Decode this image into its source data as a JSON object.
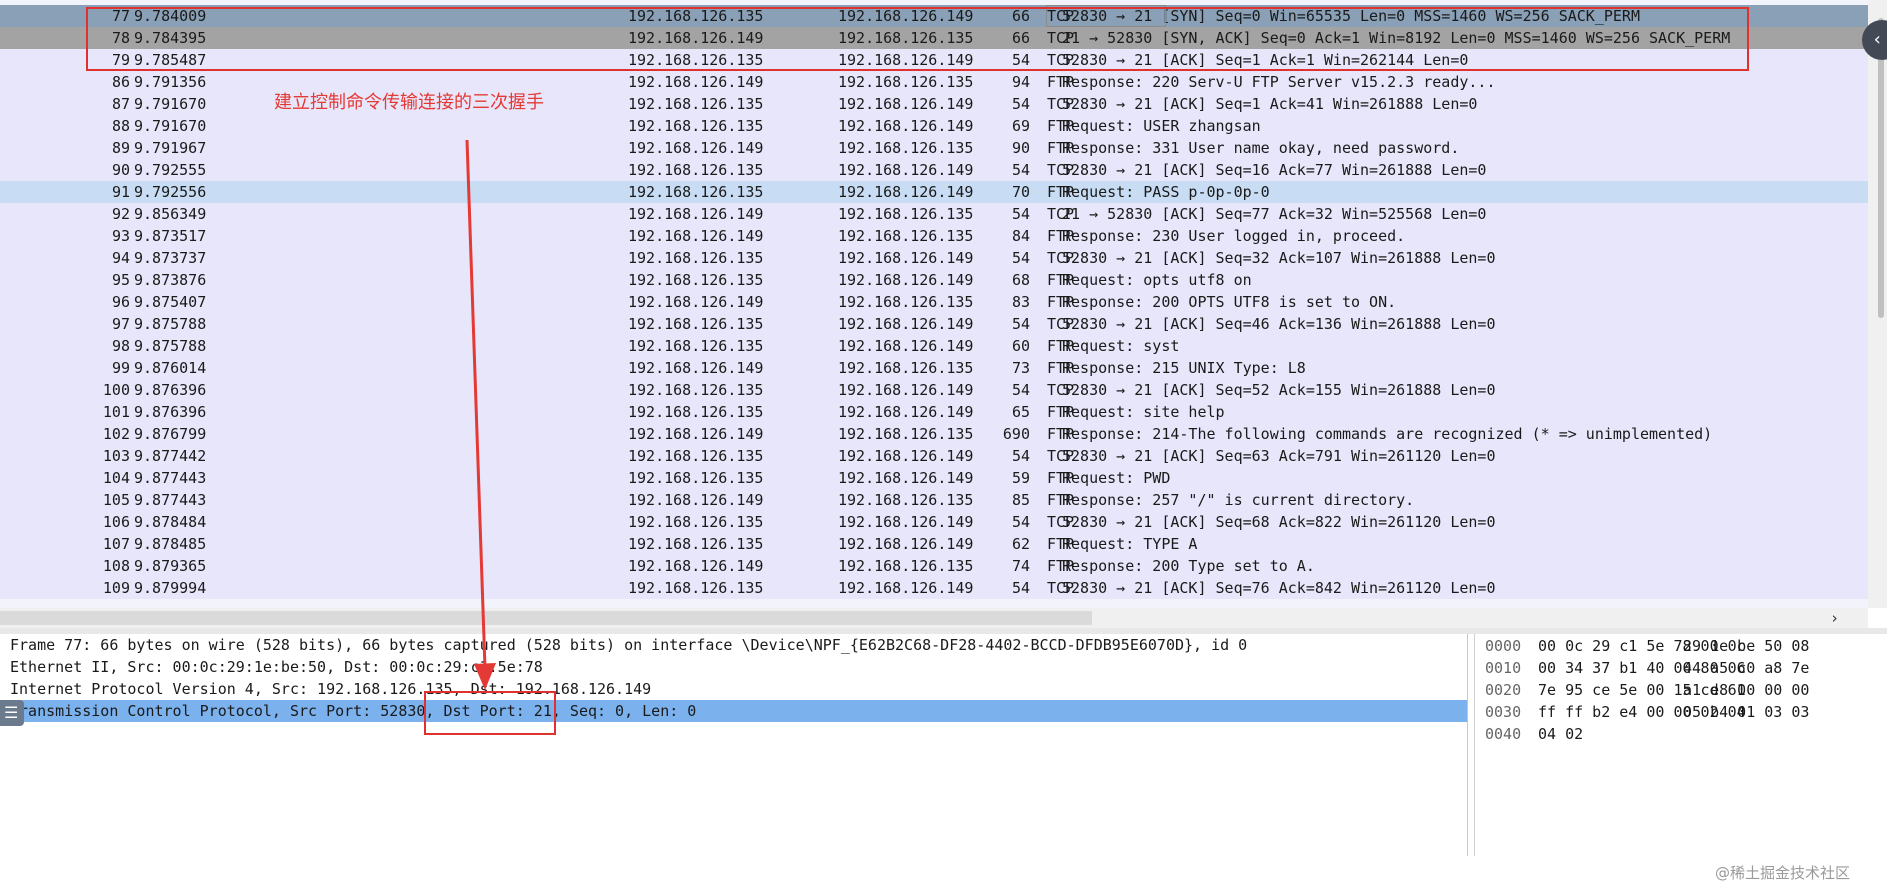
{
  "packet_list": {
    "rows": [
      {
        "no": "77",
        "time": "9.784009",
        "src": "192.168.126.135",
        "dst": "192.168.126.149",
        "proto": "TCP",
        "len": "66",
        "info": "52830 → 21 [SYN] Seq=0 Win=65535 Len=0 MSS=1460 WS=256 SACK_PERM"
      },
      {
        "no": "78",
        "time": "9.784395",
        "src": "192.168.126.149",
        "dst": "192.168.126.135",
        "proto": "TCP",
        "len": "66",
        "info": "21 → 52830 [SYN, ACK] Seq=0 Ack=1 Win=8192 Len=0 MSS=1460 WS=256 SACK_PERM"
      },
      {
        "no": "79",
        "time": "9.785487",
        "src": "192.168.126.135",
        "dst": "192.168.126.149",
        "proto": "TCP",
        "len": "54",
        "info": "52830 → 21 [ACK] Seq=1 Ack=1 Win=262144 Len=0"
      },
      {
        "no": "86",
        "time": "9.791356",
        "src": "192.168.126.149",
        "dst": "192.168.126.135",
        "proto": "FTP",
        "len": "94",
        "info": "Response: 220 Serv-U FTP Server v15.2.3 ready..."
      },
      {
        "no": "87",
        "time": "9.791670",
        "src": "192.168.126.135",
        "dst": "192.168.126.149",
        "proto": "TCP",
        "len": "54",
        "info": "52830 → 21 [ACK] Seq=1 Ack=41 Win=261888 Len=0"
      },
      {
        "no": "88",
        "time": "9.791670",
        "src": "192.168.126.135",
        "dst": "192.168.126.149",
        "proto": "FTP",
        "len": "69",
        "info": "Request: USER zhangsan"
      },
      {
        "no": "89",
        "time": "9.791967",
        "src": "192.168.126.149",
        "dst": "192.168.126.135",
        "proto": "FTP",
        "len": "90",
        "info": "Response: 331 User name okay, need password."
      },
      {
        "no": "90",
        "time": "9.792555",
        "src": "192.168.126.135",
        "dst": "192.168.126.149",
        "proto": "TCP",
        "len": "54",
        "info": "52830 → 21 [ACK] Seq=16 Ack=77 Win=261888 Len=0"
      },
      {
        "no": "91",
        "time": "9.792556",
        "src": "192.168.126.135",
        "dst": "192.168.126.149",
        "proto": "FTP",
        "len": "70",
        "info": "Request: PASS p-0p-0p-0"
      },
      {
        "no": "92",
        "time": "9.856349",
        "src": "192.168.126.149",
        "dst": "192.168.126.135",
        "proto": "TCP",
        "len": "54",
        "info": "21 → 52830 [ACK] Seq=77 Ack=32 Win=525568 Len=0"
      },
      {
        "no": "93",
        "time": "9.873517",
        "src": "192.168.126.149",
        "dst": "192.168.126.135",
        "proto": "FTP",
        "len": "84",
        "info": "Response: 230 User logged in, proceed."
      },
      {
        "no": "94",
        "time": "9.873737",
        "src": "192.168.126.135",
        "dst": "192.168.126.149",
        "proto": "TCP",
        "len": "54",
        "info": "52830 → 21 [ACK] Seq=32 Ack=107 Win=261888 Len=0"
      },
      {
        "no": "95",
        "time": "9.873876",
        "src": "192.168.126.135",
        "dst": "192.168.126.149",
        "proto": "FTP",
        "len": "68",
        "info": "Request: opts utf8 on"
      },
      {
        "no": "96",
        "time": "9.875407",
        "src": "192.168.126.149",
        "dst": "192.168.126.135",
        "proto": "FTP",
        "len": "83",
        "info": "Response: 200 OPTS UTF8 is set to ON."
      },
      {
        "no": "97",
        "time": "9.875788",
        "src": "192.168.126.135",
        "dst": "192.168.126.149",
        "proto": "TCP",
        "len": "54",
        "info": "52830 → 21 [ACK] Seq=46 Ack=136 Win=261888 Len=0"
      },
      {
        "no": "98",
        "time": "9.875788",
        "src": "192.168.126.135",
        "dst": "192.168.126.149",
        "proto": "FTP",
        "len": "60",
        "info": "Request: syst"
      },
      {
        "no": "99",
        "time": "9.876014",
        "src": "192.168.126.149",
        "dst": "192.168.126.135",
        "proto": "FTP",
        "len": "73",
        "info": "Response: 215 UNIX Type: L8"
      },
      {
        "no": "100",
        "time": "9.876396",
        "src": "192.168.126.135",
        "dst": "192.168.126.149",
        "proto": "TCP",
        "len": "54",
        "info": "52830 → 21 [ACK] Seq=52 Ack=155 Win=261888 Len=0"
      },
      {
        "no": "101",
        "time": "9.876396",
        "src": "192.168.126.135",
        "dst": "192.168.126.149",
        "proto": "FTP",
        "len": "65",
        "info": "Request: site help"
      },
      {
        "no": "102",
        "time": "9.876799",
        "src": "192.168.126.149",
        "dst": "192.168.126.135",
        "proto": "FTP",
        "len": "690",
        "info": "Response: 214-The following commands are recognized (* => unimplemented)"
      },
      {
        "no": "103",
        "time": "9.877442",
        "src": "192.168.126.135",
        "dst": "192.168.126.149",
        "proto": "TCP",
        "len": "54",
        "info": "52830 → 21 [ACK] Seq=63 Ack=791 Win=261120 Len=0"
      },
      {
        "no": "104",
        "time": "9.877443",
        "src": "192.168.126.135",
        "dst": "192.168.126.149",
        "proto": "FTP",
        "len": "59",
        "info": "Request: PWD"
      },
      {
        "no": "105",
        "time": "9.877443",
        "src": "192.168.126.149",
        "dst": "192.168.126.135",
        "proto": "FTP",
        "len": "85",
        "info": "Response: 257 \"/\" is current directory."
      },
      {
        "no": "106",
        "time": "9.878484",
        "src": "192.168.126.135",
        "dst": "192.168.126.149",
        "proto": "TCP",
        "len": "54",
        "info": "52830 → 21 [ACK] Seq=68 Ack=822 Win=261120 Len=0"
      },
      {
        "no": "107",
        "time": "9.878485",
        "src": "192.168.126.135",
        "dst": "192.168.126.149",
        "proto": "FTP",
        "len": "62",
        "info": "Request: TYPE A"
      },
      {
        "no": "108",
        "time": "9.879365",
        "src": "192.168.126.149",
        "dst": "192.168.126.135",
        "proto": "FTP",
        "len": "74",
        "info": "Response: 200 Type set to A."
      },
      {
        "no": "109",
        "time": "9.879994",
        "src": "192.168.126.135",
        "dst": "192.168.126.149",
        "proto": "TCP",
        "len": "54",
        "info": "52830 → 21 [ACK] Seq=76 Ack=842 Win=261120 Len=0"
      }
    ]
  },
  "details": {
    "lines": [
      "Frame 77: 66 bytes on wire (528 bits), 66 bytes captured (528 bits) on interface \\Device\\NPF_{E62B2C68-DF28-4402-BCCD-DFDB95E6070D}, id 0",
      "Ethernet II, Src: 00:0c:29:1e:be:50, Dst: 00:0c:29:c1:5e:78",
      "Internet Protocol Version 4, Src: 192.168.126.135, Dst: 192.168.126.149",
      "Transmission Control Protocol, Src Port: 52830, Dst Port: 21, Seq: 0, Len: 0"
    ]
  },
  "bytes": {
    "rows": [
      {
        "offset": "0000",
        "hex1": "00 0c 29 c1 5e 78 00 0c",
        "hex2": "29 1e be 50 08"
      },
      {
        "offset": "0010",
        "hex1": "00 34 37 b1 40 00 80 06",
        "hex2": "44 a5 c0 a8 7e"
      },
      {
        "offset": "0020",
        "hex1": "7e 95 ce 5e 00 15 cd 61",
        "hex2": "a1 e8 00 00 00"
      },
      {
        "offset": "0030",
        "hex1": "ff ff b2 e4 00 00 02 04",
        "hex2": "05 b4 01 03 03"
      },
      {
        "offset": "0040",
        "hex1": "04 02",
        "hex2": ""
      }
    ]
  },
  "annotation": {
    "text": "建立控制命令传输连接的三次握手",
    "color": "#e53935"
  },
  "scrollbar": {
    "right_arrow": "›"
  },
  "watermark": "@稀土掘金技术社区"
}
